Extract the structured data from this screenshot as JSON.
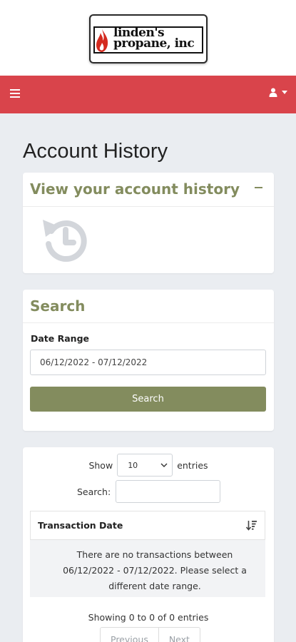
{
  "brand": {
    "logo_text_line1": "linden's",
    "logo_text_line2": "propane, inc"
  },
  "nav": {
    "menu_icon": "hamburger-icon",
    "user_icon": "user-icon",
    "bar_color": "#d9444b"
  },
  "page": {
    "title": "Account History"
  },
  "history_card": {
    "title": "View your account history",
    "collapse_icon": "minus-icon",
    "icon": "history-icon",
    "accent_color": "#838c5e"
  },
  "search_card": {
    "title": "Search",
    "date_range_label": "Date Range",
    "date_range_value": "06/12/2022 - 07/12/2022",
    "search_button_label": "Search"
  },
  "table": {
    "show_label": "Show",
    "entries_label": "entries",
    "page_length": "10",
    "search_label": "Search:",
    "search_value": "",
    "columns": [
      "Transaction Date"
    ],
    "sort_icon": "sort-amount-down-icon",
    "empty_message": "There are no transactions between 06/12/2022 - 07/12/2022. Please select a different date range.",
    "info": "Showing 0 to 0 of 0 entries",
    "previous_label": "Previous",
    "next_label": "Next"
  }
}
